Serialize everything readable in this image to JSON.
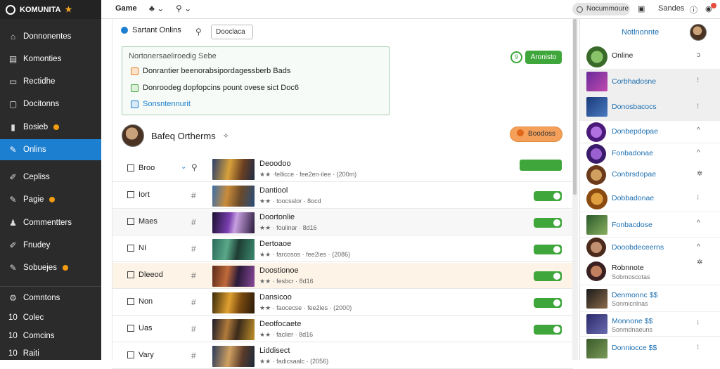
{
  "topbar": {
    "logo_text": "KOMUNITA",
    "game_label": "Game",
    "search_pill": "Nocummoure",
    "right_label": "Sandes"
  },
  "sidebar": {
    "items": [
      {
        "label": "Donnonentes",
        "icon": "home-icon"
      },
      {
        "label": "Komonties",
        "icon": "list-icon"
      },
      {
        "label": "Rectidhe",
        "icon": "inbox-icon"
      },
      {
        "label": "Docitonns",
        "icon": "document-icon"
      },
      {
        "label": "Bosieb",
        "icon": "chart-icon",
        "badge": true
      },
      {
        "label": "Onlins",
        "icon": "edit-icon",
        "active": true
      },
      {
        "label": "Cepliss",
        "icon": "wrench-icon"
      },
      {
        "label": "Pagie",
        "icon": "pin-icon",
        "badge": true
      },
      {
        "label": "Commentters",
        "icon": "user-icon"
      },
      {
        "label": "Fnudey",
        "icon": "pen-icon"
      },
      {
        "label": "Sobuejes",
        "icon": "gear-icon",
        "badge": true
      }
    ],
    "bottom": [
      {
        "label": "Comntons",
        "prefix": "⚙"
      },
      {
        "label": "Colec",
        "prefix": "10"
      },
      {
        "label": "Comcins",
        "prefix": "10"
      },
      {
        "label": "Raiti",
        "prefix": "10"
      }
    ]
  },
  "main": {
    "tab_title": "Sartant Onlins",
    "search_value": "Dooclaca",
    "notice": {
      "title": "Nortonersaeliroedig Sebe",
      "lines": [
        {
          "text": "Donrantier beenorabsipordagessberb Bads",
          "color": "#e67e22"
        },
        {
          "text": "Donroodeg dopfopcins pount ovese sict Doc6",
          "color": "#3ea63b"
        },
        {
          "text": "Sonsntennurit",
          "color": "#1d7fd0",
          "link": true
        }
      ]
    },
    "green_button": "Aronisto",
    "green_circle": "9",
    "user_name": "Bafeq Ortherms",
    "orange_button": "Boodoss",
    "rows": [
      {
        "label": "Broo",
        "name": "Deoodoo",
        "meta": "★★ ·fellicce · fee2en·ilee · (200m)",
        "thumb": "a"
      },
      {
        "label": "Iort",
        "name": "Dantiool",
        "meta": "★★ · toocsslor · 8ocd",
        "thumb": "b"
      },
      {
        "label": "Maes",
        "name": "Doortonlie",
        "meta": "★★ · foulinar · 8d16",
        "thumb": "c"
      },
      {
        "label": "NI",
        "name": "Dertoaoe",
        "meta": "★★ · farcosos · fee2ies · (2086)",
        "thumb": "d"
      },
      {
        "label": "Dleeod",
        "name": "Doostionoe",
        "meta": "★★ · fesbcr · 8d16",
        "thumb": "e"
      },
      {
        "label": "Non",
        "name": "Dansicoo",
        "meta": "★★ · faocecse · fee2ies · (2000)",
        "thumb": "f"
      },
      {
        "label": "Uas",
        "name": "Deotfocaete",
        "meta": "★★ · faclier · 8d16",
        "thumb": "g"
      },
      {
        "label": "Vary",
        "name": "Liddisect",
        "meta": "★★ · fadicsaalc · (2056)",
        "thumb": "h"
      }
    ]
  },
  "right_panel": {
    "title": "Notlnonnte",
    "items": [
      {
        "text": "Online",
        "action": "ɔ",
        "dark": true
      },
      {
        "text": "Corbhadosne",
        "action": "⁝"
      },
      {
        "text": "Donosbacocs",
        "action": "⁝"
      },
      {
        "text": "Donbepdopae",
        "action": "^"
      },
      {
        "text": "Fonbadonae",
        "action": "^"
      },
      {
        "text": "Conbrsdopae",
        "action": "⁝"
      },
      {
        "text": "Dobbadonae",
        "action": "⁝"
      },
      {
        "text": "Fonbacdose",
        "action": "^"
      },
      {
        "text": "Dooobdeceerns",
        "action": "^"
      },
      {
        "text": "Robnnote",
        "sub": "Sobmoscotas",
        "action": ""
      },
      {
        "text": "Denmonnc $$",
        "sub": "Sonmicnlnas",
        "action": ""
      },
      {
        "text": "Monnone $$",
        "sub": "Sonmdnaeuns",
        "action": "⁝"
      },
      {
        "text": "Donniocce $$",
        "sub": "",
        "action": "⁝"
      }
    ]
  }
}
